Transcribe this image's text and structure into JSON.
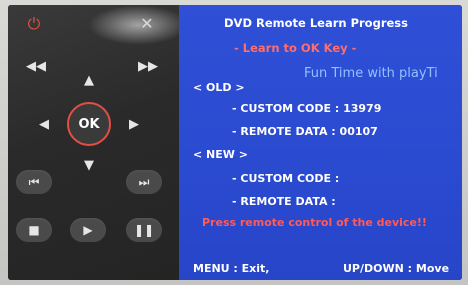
{
  "remote": {
    "power_icon": "power-icon",
    "ok_label": "OK",
    "colors": {
      "accent": "#e24f44"
    }
  },
  "panel": {
    "title": "DVD Remote Learn Progress",
    "subtitle": "- Learn to OK Key -",
    "overlay_text": "Fun Time with playTi",
    "old_header": "< OLD >",
    "old_custom_code": "- CUSTOM CODE :  13979",
    "old_remote_data": "- REMOTE DATA :  00107",
    "new_header": "< NEW >",
    "new_custom_code": "- CUSTOM CODE :",
    "new_remote_data": "- REMOTE DATA :",
    "warning": "Press remote control of the device!!",
    "footer_left": "MENU : Exit,",
    "footer_right": "UP/DOWN : Move",
    "colors": {
      "background": "#2f4fd6",
      "highlight": "#ff5a5a",
      "overlay": "#8fc3ff"
    }
  }
}
